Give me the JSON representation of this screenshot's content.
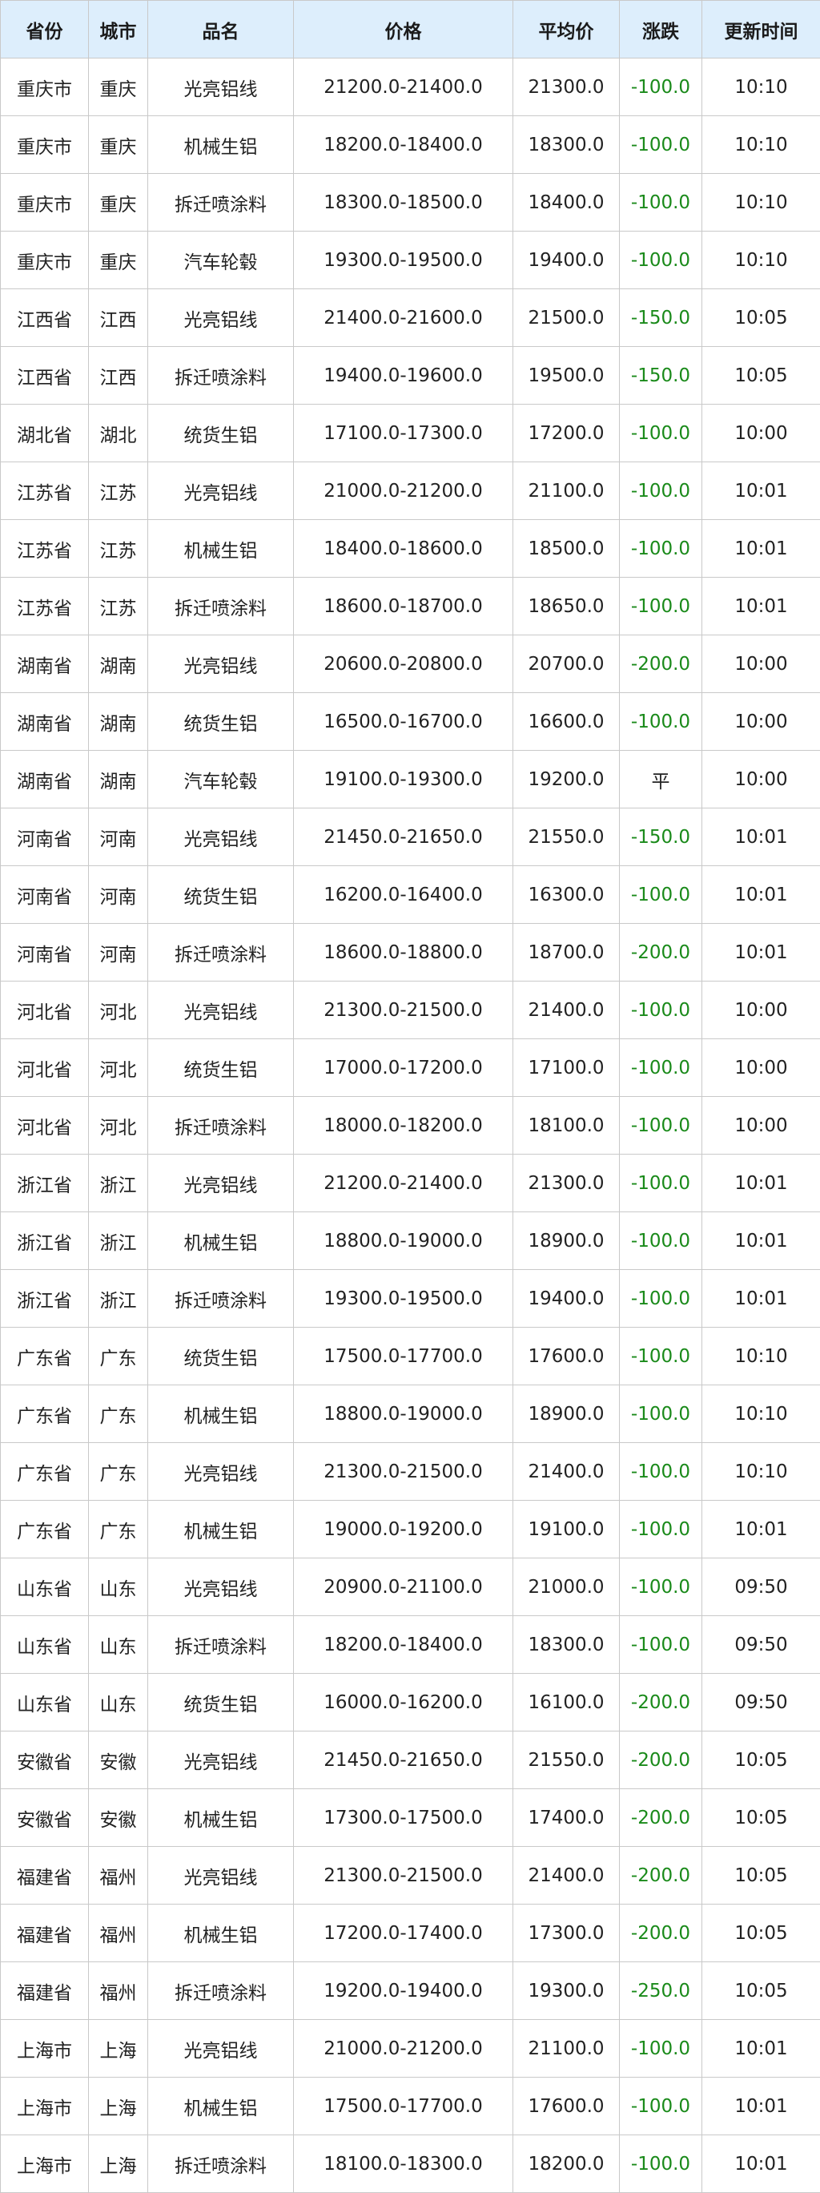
{
  "headers": [
    "省份",
    "城市",
    "品名",
    "价格",
    "平均价",
    "涨跌",
    "更新时间"
  ],
  "colors": {
    "header_bg": "#ddeefc",
    "down": "#1a8a1a",
    "border": "#c9c9c9"
  },
  "rows": [
    [
      "重庆市",
      "重庆",
      "光亮铝线",
      "21200.0-21400.0",
      "21300.0",
      "-100.0",
      "10:10"
    ],
    [
      "重庆市",
      "重庆",
      "机械生铝",
      "18200.0-18400.0",
      "18300.0",
      "-100.0",
      "10:10"
    ],
    [
      "重庆市",
      "重庆",
      "拆迁喷涂料",
      "18300.0-18500.0",
      "18400.0",
      "-100.0",
      "10:10"
    ],
    [
      "重庆市",
      "重庆",
      "汽车轮毂",
      "19300.0-19500.0",
      "19400.0",
      "-100.0",
      "10:10"
    ],
    [
      "江西省",
      "江西",
      "光亮铝线",
      "21400.0-21600.0",
      "21500.0",
      "-150.0",
      "10:05"
    ],
    [
      "江西省",
      "江西",
      "拆迁喷涂料",
      "19400.0-19600.0",
      "19500.0",
      "-150.0",
      "10:05"
    ],
    [
      "湖北省",
      "湖北",
      "统货生铝",
      "17100.0-17300.0",
      "17200.0",
      "-100.0",
      "10:00"
    ],
    [
      "江苏省",
      "江苏",
      "光亮铝线",
      "21000.0-21200.0",
      "21100.0",
      "-100.0",
      "10:01"
    ],
    [
      "江苏省",
      "江苏",
      "机械生铝",
      "18400.0-18600.0",
      "18500.0",
      "-100.0",
      "10:01"
    ],
    [
      "江苏省",
      "江苏",
      "拆迁喷涂料",
      "18600.0-18700.0",
      "18650.0",
      "-100.0",
      "10:01"
    ],
    [
      "湖南省",
      "湖南",
      "光亮铝线",
      "20600.0-20800.0",
      "20700.0",
      "-200.0",
      "10:00"
    ],
    [
      "湖南省",
      "湖南",
      "统货生铝",
      "16500.0-16700.0",
      "16600.0",
      "-100.0",
      "10:00"
    ],
    [
      "湖南省",
      "湖南",
      "汽车轮毂",
      "19100.0-19300.0",
      "19200.0",
      "平",
      "10:00"
    ],
    [
      "河南省",
      "河南",
      "光亮铝线",
      "21450.0-21650.0",
      "21550.0",
      "-150.0",
      "10:01"
    ],
    [
      "河南省",
      "河南",
      "统货生铝",
      "16200.0-16400.0",
      "16300.0",
      "-100.0",
      "10:01"
    ],
    [
      "河南省",
      "河南",
      "拆迁喷涂料",
      "18600.0-18800.0",
      "18700.0",
      "-200.0",
      "10:01"
    ],
    [
      "河北省",
      "河北",
      "光亮铝线",
      "21300.0-21500.0",
      "21400.0",
      "-100.0",
      "10:00"
    ],
    [
      "河北省",
      "河北",
      "统货生铝",
      "17000.0-17200.0",
      "17100.0",
      "-100.0",
      "10:00"
    ],
    [
      "河北省",
      "河北",
      "拆迁喷涂料",
      "18000.0-18200.0",
      "18100.0",
      "-100.0",
      "10:00"
    ],
    [
      "浙江省",
      "浙江",
      "光亮铝线",
      "21200.0-21400.0",
      "21300.0",
      "-100.0",
      "10:01"
    ],
    [
      "浙江省",
      "浙江",
      "机械生铝",
      "18800.0-19000.0",
      "18900.0",
      "-100.0",
      "10:01"
    ],
    [
      "浙江省",
      "浙江",
      "拆迁喷涂料",
      "19300.0-19500.0",
      "19400.0",
      "-100.0",
      "10:01"
    ],
    [
      "广东省",
      "广东",
      "统货生铝",
      "17500.0-17700.0",
      "17600.0",
      "-100.0",
      "10:10"
    ],
    [
      "广东省",
      "广东",
      "机械生铝",
      "18800.0-19000.0",
      "18900.0",
      "-100.0",
      "10:10"
    ],
    [
      "广东省",
      "广东",
      "光亮铝线",
      "21300.0-21500.0",
      "21400.0",
      "-100.0",
      "10:10"
    ],
    [
      "广东省",
      "广东",
      "机械生铝",
      "19000.0-19200.0",
      "19100.0",
      "-100.0",
      "10:01"
    ],
    [
      "山东省",
      "山东",
      "光亮铝线",
      "20900.0-21100.0",
      "21000.0",
      "-100.0",
      "09:50"
    ],
    [
      "山东省",
      "山东",
      "拆迁喷涂料",
      "18200.0-18400.0",
      "18300.0",
      "-100.0",
      "09:50"
    ],
    [
      "山东省",
      "山东",
      "统货生铝",
      "16000.0-16200.0",
      "16100.0",
      "-200.0",
      "09:50"
    ],
    [
      "安徽省",
      "安徽",
      "光亮铝线",
      "21450.0-21650.0",
      "21550.0",
      "-200.0",
      "10:05"
    ],
    [
      "安徽省",
      "安徽",
      "机械生铝",
      "17300.0-17500.0",
      "17400.0",
      "-200.0",
      "10:05"
    ],
    [
      "福建省",
      "福州",
      "光亮铝线",
      "21300.0-21500.0",
      "21400.0",
      "-200.0",
      "10:05"
    ],
    [
      "福建省",
      "福州",
      "机械生铝",
      "17200.0-17400.0",
      "17300.0",
      "-200.0",
      "10:05"
    ],
    [
      "福建省",
      "福州",
      "拆迁喷涂料",
      "19200.0-19400.0",
      "19300.0",
      "-250.0",
      "10:05"
    ],
    [
      "上海市",
      "上海",
      "光亮铝线",
      "21000.0-21200.0",
      "21100.0",
      "-100.0",
      "10:01"
    ],
    [
      "上海市",
      "上海",
      "机械生铝",
      "17500.0-17700.0",
      "17600.0",
      "-100.0",
      "10:01"
    ],
    [
      "上海市",
      "上海",
      "拆迁喷涂料",
      "18100.0-18300.0",
      "18200.0",
      "-100.0",
      "10:01"
    ]
  ]
}
